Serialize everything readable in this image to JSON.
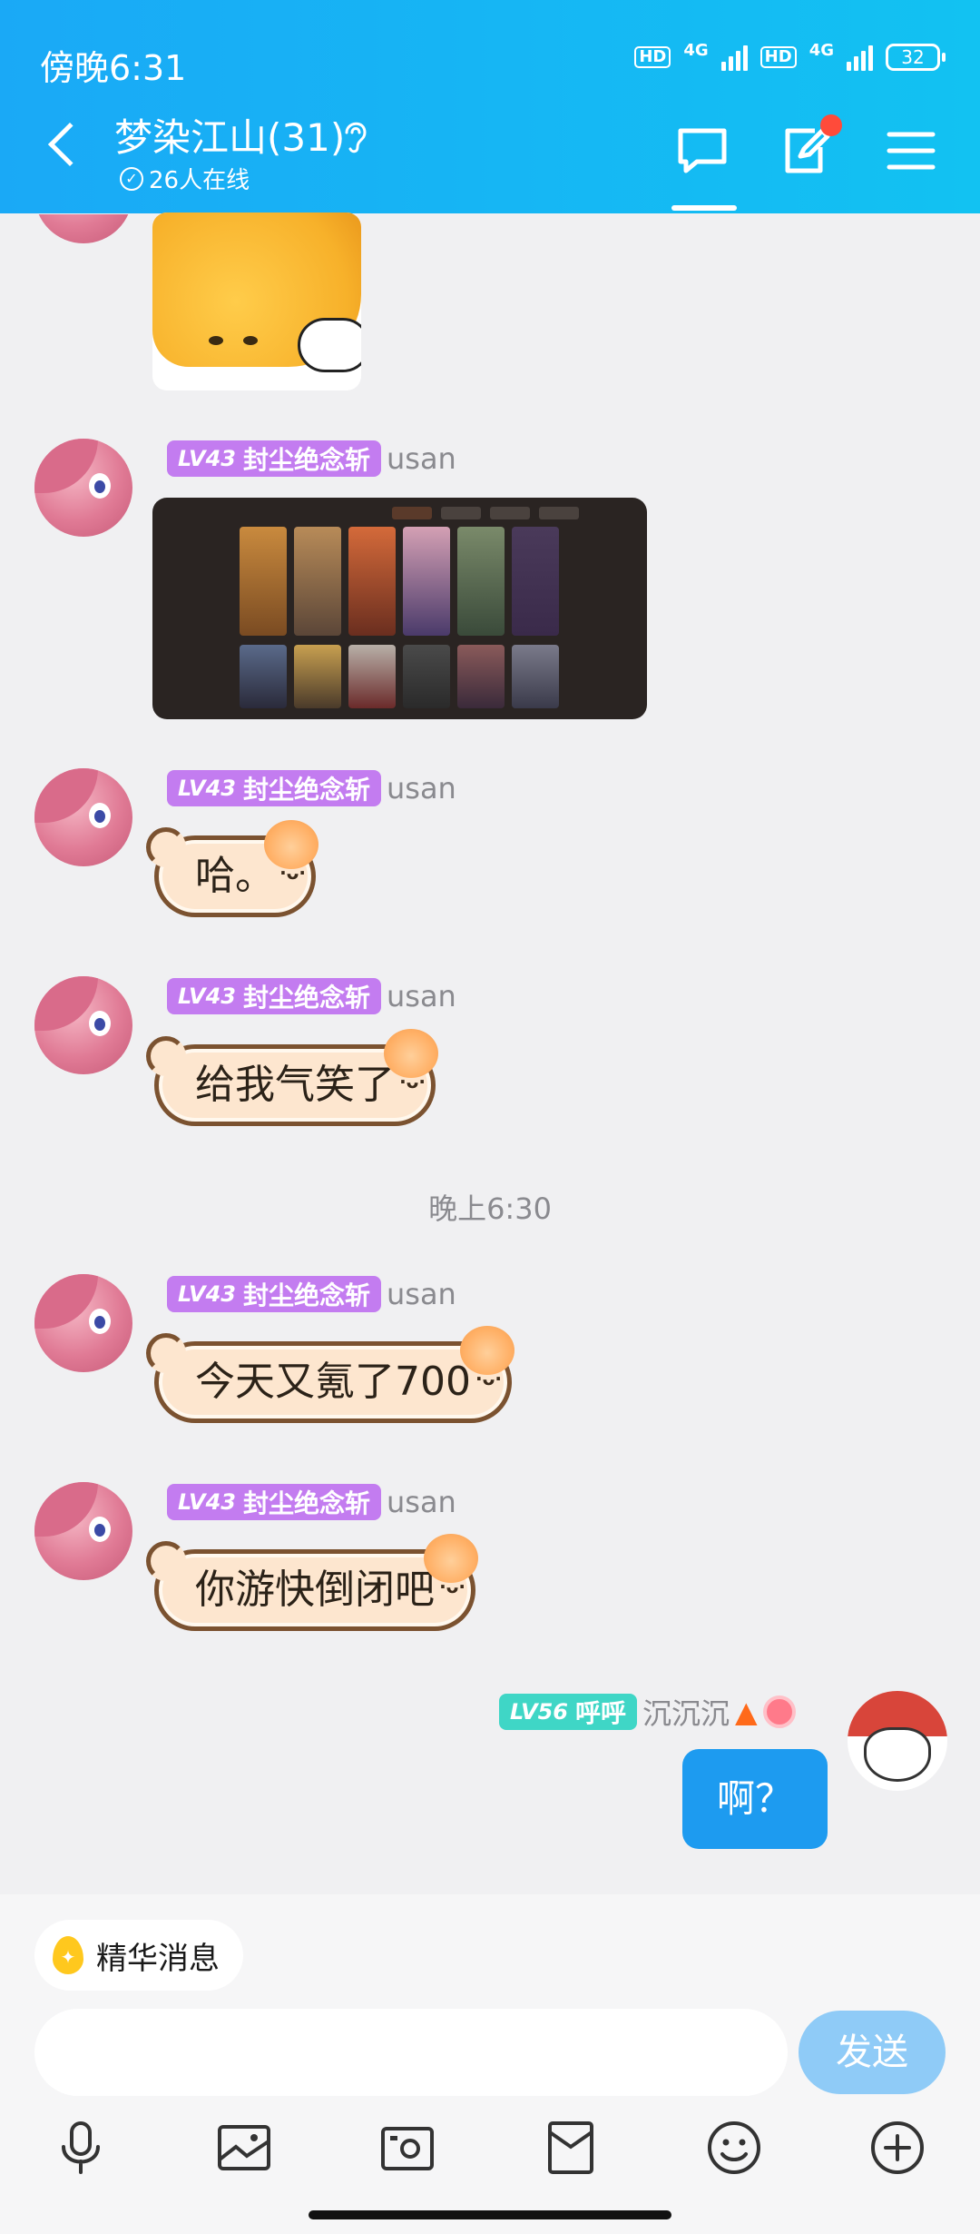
{
  "status_bar": {
    "time": "傍晚6:31",
    "hd_label": "HD",
    "network": "4G",
    "battery": "32"
  },
  "header": {
    "title": "梦染江山(31)",
    "online_count": "26人在线",
    "colors": {
      "accent": "#1aa9f6",
      "notification_dot": "#ff4b3a"
    }
  },
  "messages": [
    {
      "sender_level": "LV43",
      "sender_title": "封尘绝念斩",
      "sender_name": "usan",
      "type": "image-screenshot"
    },
    {
      "sender_level": "LV43",
      "sender_title": "封尘绝念斩",
      "sender_name": "usan",
      "text": "哈。"
    },
    {
      "sender_level": "LV43",
      "sender_title": "封尘绝念斩",
      "sender_name": "usan",
      "text": "给我气笑了"
    },
    {
      "sender_level": "LV43",
      "sender_title": "封尘绝念斩",
      "sender_name": "usan",
      "text": "今天又氪了700"
    },
    {
      "sender_level": "LV43",
      "sender_title": "封尘绝念斩",
      "sender_name": "usan",
      "text": "你游快倒闭吧"
    }
  ],
  "time_separator": "晚上6:30",
  "my_message": {
    "level": "LV56",
    "title": "呼呼",
    "name": "沉沉沉",
    "text": "啊？"
  },
  "bottom": {
    "essence_label": "精华消息",
    "send_label": "发送",
    "input_value": ""
  }
}
